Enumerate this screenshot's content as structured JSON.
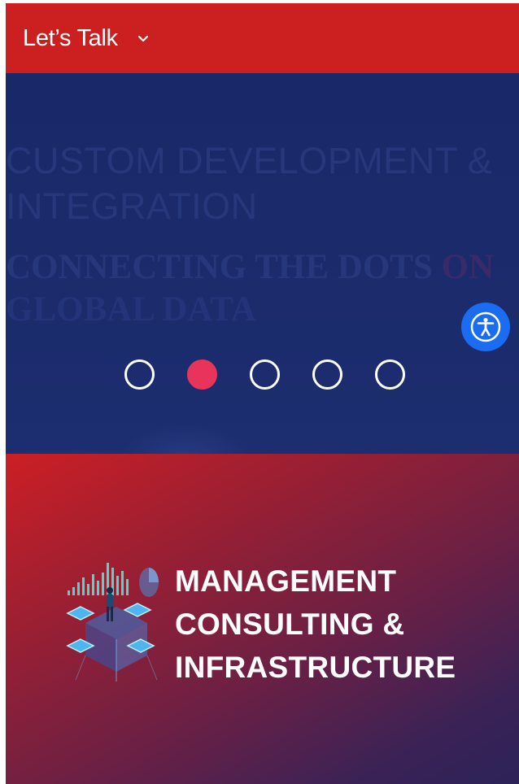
{
  "header": {
    "menu_label": "Let’s Talk",
    "menu_icon": "chevron-down-icon"
  },
  "hero": {
    "title_line1": "CUSTOM DEVELOPMENT &",
    "title_line2": "INTEGRATION",
    "subtitle_main": "CONNECTING THE DOTS",
    "subtitle_tail": "ON",
    "subtitle_line2": "GLOBAL DATA",
    "slides_count": 5,
    "active_slide": 2
  },
  "accessibility": {
    "icon": "accessibility-icon"
  },
  "service": {
    "icon": "data-platform-illustration",
    "title_lines": [
      "MANAGEMENT",
      "CONSULTING &",
      "INFRASTRUCTURE"
    ]
  },
  "colors": {
    "header_bg": "#cc1f1f",
    "hero_bg": "#192868",
    "dot_active": "#e8345a",
    "a11y_bg": "#1a6cf0",
    "service_gradient_start": "#cc1f24",
    "service_gradient_end": "#2c2358"
  }
}
